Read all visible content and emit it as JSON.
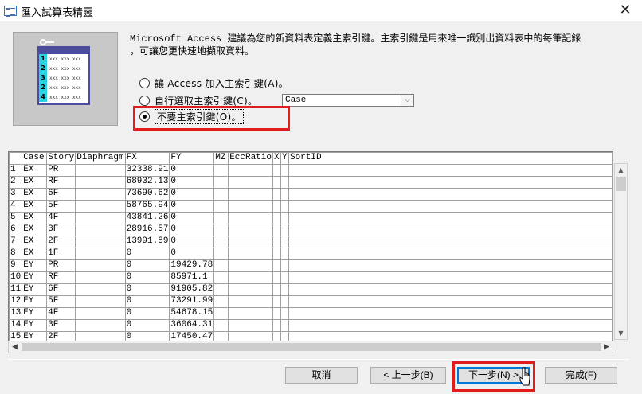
{
  "window": {
    "title": "匯入試算表精靈",
    "close_glyph": "✕"
  },
  "description": {
    "line1": "Microsoft Access 建議為您的新資料表定義主索引鍵。主索引鍵是用來唯一識別出資料表中的每筆記錄",
    "line2": "，可讓您更快速地擷取資料。"
  },
  "illustration": {
    "row_numbers": [
      "1",
      "2",
      "3",
      "2",
      "4"
    ],
    "cell_text": "xxx xxx xxx"
  },
  "options": [
    {
      "label": "讓 Access 加入主索引鍵(A)。",
      "checked": false
    },
    {
      "label": "自行選取主索引鍵(C)。",
      "checked": false
    },
    {
      "label": "不要主索引鍵(O)。",
      "checked": true
    }
  ],
  "key_field_combo": {
    "value": "Case",
    "arrow": "⌵"
  },
  "grid": {
    "columns": [
      "Case",
      "Story",
      "Diaphragm",
      "FX",
      "FY",
      "MZ",
      "EccRatio",
      "X",
      "Y",
      "SortID"
    ],
    "rows": [
      [
        "1",
        "EX",
        "PR",
        "",
        "32338.91",
        "0",
        "",
        "",
        "",
        "",
        ""
      ],
      [
        "2",
        "EX",
        "RF",
        "",
        "68932.13",
        "0",
        "",
        "",
        "",
        "",
        ""
      ],
      [
        "3",
        "EX",
        "6F",
        "",
        "73690.62",
        "0",
        "",
        "",
        "",
        "",
        ""
      ],
      [
        "4",
        "EX",
        "5F",
        "",
        "58765.94",
        "0",
        "",
        "",
        "",
        "",
        ""
      ],
      [
        "5",
        "EX",
        "4F",
        "",
        "43841.26",
        "0",
        "",
        "",
        "",
        "",
        ""
      ],
      [
        "6",
        "EX",
        "3F",
        "",
        "28916.57",
        "0",
        "",
        "",
        "",
        "",
        ""
      ],
      [
        "7",
        "EX",
        "2F",
        "",
        "13991.89",
        "0",
        "",
        "",
        "",
        "",
        ""
      ],
      [
        "8",
        "EX",
        "1F",
        "",
        "0",
        "0",
        "",
        "",
        "",
        "",
        ""
      ],
      [
        "9",
        "EY",
        "PR",
        "",
        "0",
        "19429.78",
        "",
        "",
        "",
        "",
        ""
      ],
      [
        "10",
        "EY",
        "RF",
        "",
        "0",
        "85971.1",
        "",
        "",
        "",
        "",
        ""
      ],
      [
        "11",
        "EY",
        "6F",
        "",
        "0",
        "91905.82",
        "",
        "",
        "",
        "",
        ""
      ],
      [
        "12",
        "EY",
        "5F",
        "",
        "0",
        "73291.99",
        "",
        "",
        "",
        "",
        ""
      ],
      [
        "13",
        "EY",
        "4F",
        "",
        "0",
        "54678.15",
        "",
        "",
        "",
        "",
        ""
      ],
      [
        "14",
        "EY",
        "3F",
        "",
        "0",
        "36064.31",
        "",
        "",
        "",
        "",
        ""
      ],
      [
        "15",
        "EY",
        "2F",
        "",
        "0",
        "17450.47",
        "",
        "",
        "",
        "",
        ""
      ]
    ]
  },
  "scroll_glyphs": {
    "up": "▲",
    "down": "▼",
    "left": "◀",
    "right": "▶"
  },
  "buttons": {
    "cancel": "取消",
    "back": "< 上一步(B)",
    "next": "下一步(N) >",
    "finish": "完成(F)"
  },
  "colors": {
    "highlight": "#e01c1c",
    "accent": "#0078d7",
    "mini_table_header": "#4b4ba0",
    "mini_table_rownum": "#27d3e0"
  }
}
